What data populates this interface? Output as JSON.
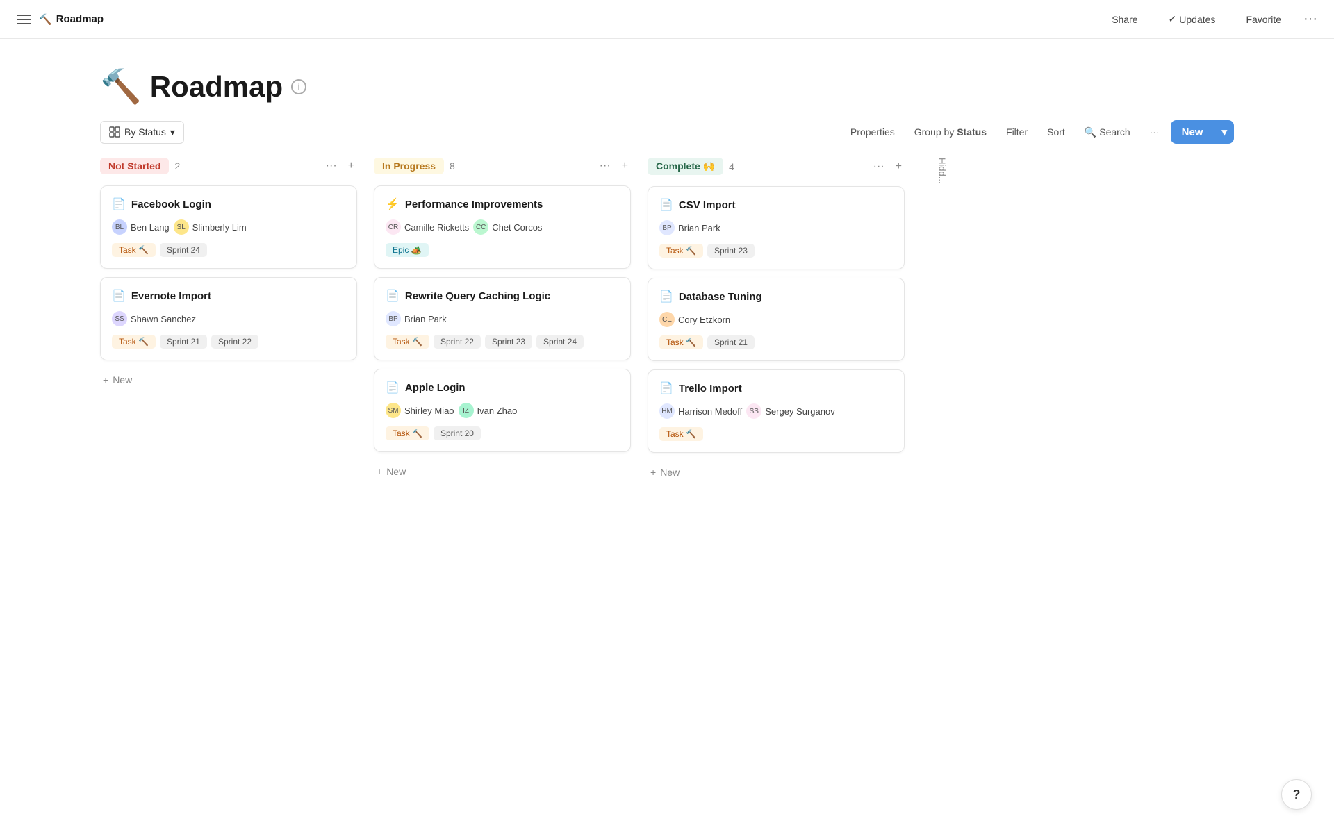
{
  "topbar": {
    "title": "Roadmap",
    "icon": "🔨",
    "share": "Share",
    "updates": "Updates",
    "favorite": "Favorite"
  },
  "page": {
    "icon": "🔨",
    "title": "Roadmap",
    "info_label": "i"
  },
  "toolbar": {
    "view_label": "By Status",
    "properties": "Properties",
    "group_by": "Group by",
    "group_by_value": "Status",
    "filter": "Filter",
    "sort": "Sort",
    "search": "Search",
    "more": "···",
    "new_label": "New",
    "new_caret": "▾"
  },
  "columns": [
    {
      "id": "not-started",
      "status": "Not Started",
      "badge_class": "badge-not-started",
      "count": 2,
      "cards": [
        {
          "icon": "📄",
          "title": "Facebook Login",
          "assignees": [
            {
              "name": "Ben Lang",
              "avatar_text": "BL",
              "avatar_color": "#c7d2fe"
            },
            {
              "name": "Slimberly Lim",
              "avatar_text": "SL",
              "avatar_color": "#fde68a"
            }
          ],
          "tags": [
            {
              "label": "Task 🔨",
              "class": "tag-task"
            },
            {
              "label": "Sprint 24",
              "class": "tag-sprint"
            }
          ]
        },
        {
          "icon": "📄",
          "title": "Evernote Import",
          "assignees": [
            {
              "name": "Shawn Sanchez",
              "avatar_text": "SS",
              "avatar_color": "#ddd6fe"
            }
          ],
          "tags": [
            {
              "label": "Task 🔨",
              "class": "tag-task"
            },
            {
              "label": "Sprint 21",
              "class": "tag-sprint"
            },
            {
              "label": "Sprint 22",
              "class": "tag-sprint"
            }
          ]
        }
      ],
      "add_label": "New"
    },
    {
      "id": "in-progress",
      "status": "In Progress",
      "badge_class": "badge-in-progress",
      "count": 8,
      "cards": [
        {
          "icon": "⚡",
          "title": "Performance Improvements",
          "assignees": [
            {
              "name": "Camille Ricketts",
              "avatar_text": "CR",
              "avatar_color": "#fce7f3"
            },
            {
              "name": "Chet Corcos",
              "avatar_text": "CC",
              "avatar_color": "#bbf7d0"
            }
          ],
          "tags": [
            {
              "label": "Epic 🏕️",
              "class": "tag-epic"
            }
          ]
        },
        {
          "icon": "📄",
          "title": "Rewrite Query Caching Logic",
          "assignees": [
            {
              "name": "Brian Park",
              "avatar_text": "BP",
              "avatar_color": "#e0e7ff"
            }
          ],
          "tags": [
            {
              "label": "Task 🔨",
              "class": "tag-task"
            },
            {
              "label": "Sprint 22",
              "class": "tag-sprint"
            },
            {
              "label": "Sprint 23",
              "class": "tag-sprint"
            },
            {
              "label": "Sprint 24",
              "class": "tag-sprint"
            }
          ]
        },
        {
          "icon": "📄",
          "title": "Apple Login",
          "assignees": [
            {
              "name": "Shirley Miao",
              "avatar_text": "SM",
              "avatar_color": "#fde68a"
            },
            {
              "name": "Ivan Zhao",
              "avatar_text": "IZ",
              "avatar_color": "#a7f3d0"
            }
          ],
          "tags": [
            {
              "label": "Task 🔨",
              "class": "tag-task"
            },
            {
              "label": "Sprint 20",
              "class": "tag-sprint"
            }
          ]
        }
      ],
      "add_label": "New"
    },
    {
      "id": "complete",
      "status": "Complete 🙌",
      "badge_class": "badge-complete",
      "count": 4,
      "cards": [
        {
          "icon": "📄",
          "title": "CSV Import",
          "assignees": [
            {
              "name": "Brian Park",
              "avatar_text": "BP",
              "avatar_color": "#e0e7ff"
            }
          ],
          "tags": [
            {
              "label": "Task 🔨",
              "class": "tag-task"
            },
            {
              "label": "Sprint 23",
              "class": "tag-sprint"
            }
          ]
        },
        {
          "icon": "📄",
          "title": "Database Tuning",
          "assignees": [
            {
              "name": "Cory Etzkorn",
              "avatar_text": "CE",
              "avatar_color": "#fed7aa"
            }
          ],
          "tags": [
            {
              "label": "Task 🔨",
              "class": "tag-task"
            },
            {
              "label": "Sprint 21",
              "class": "tag-sprint"
            }
          ]
        },
        {
          "icon": "📄",
          "title": "Trello Import",
          "assignees": [
            {
              "name": "Harrison Medoff",
              "avatar_text": "HM",
              "avatar_color": "#e0e7ff"
            },
            {
              "name": "Sergey Surganov",
              "avatar_text": "SS",
              "avatar_color": "#fce7f3"
            }
          ],
          "tags": [
            {
              "label": "Task 🔨",
              "class": "tag-task"
            }
          ]
        }
      ],
      "add_label": "New"
    }
  ],
  "hidden_column": {
    "label": "Hidd..."
  },
  "help": "?"
}
